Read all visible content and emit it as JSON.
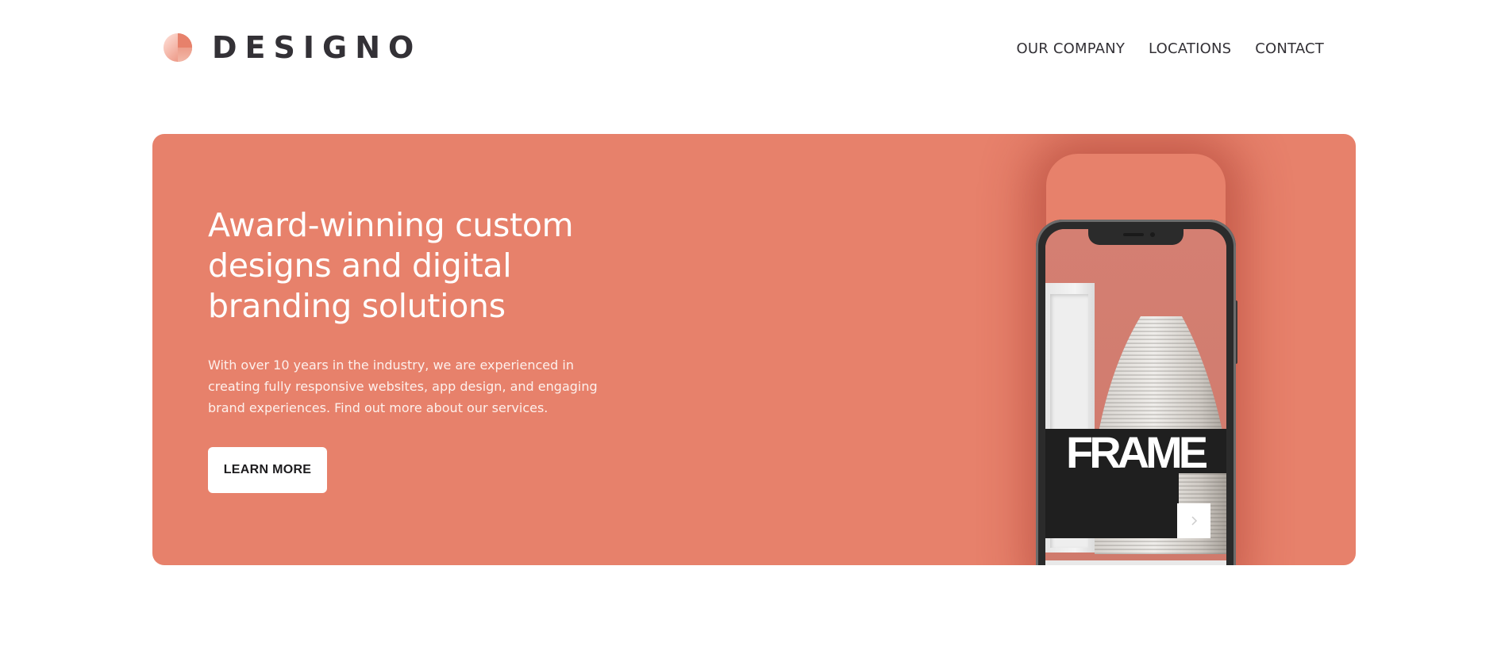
{
  "header": {
    "logo_text": "DESIGNO",
    "logo_icon": "half-circle-logo-icon",
    "nav": [
      {
        "label": "OUR COMPANY"
      },
      {
        "label": "LOCATIONS"
      },
      {
        "label": "CONTACT"
      }
    ]
  },
  "hero": {
    "heading_lines": [
      "Award-winning custom",
      "designs and digital",
      "branding solutions"
    ],
    "text": "With over 10 years in the industry, we are experienced in creating fully responsive websites, app design, and engaging brand experiences. Find out more about our services.",
    "button_label": "LEARN MORE",
    "phone_screen": {
      "word": "FRAME",
      "next_icon": "chevron-right-icon"
    }
  },
  "colors": {
    "accent": "#e7816b",
    "dark_text": "#333136",
    "white": "#ffffff"
  }
}
